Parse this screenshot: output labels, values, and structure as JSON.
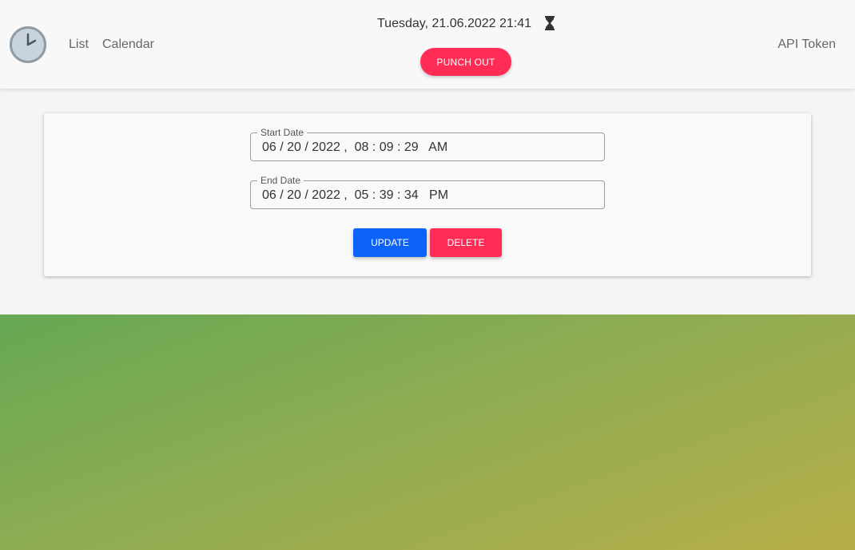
{
  "header": {
    "nav": {
      "list_label": "List",
      "calendar_label": "Calendar",
      "api_token_label": "API Token"
    },
    "datetime": "Tuesday, 21.06.2022 21:41",
    "status_icon": "hourglass-icon",
    "punch_button_label": "PUNCH OUT",
    "logo_icon": "clock-icon"
  },
  "form": {
    "start_date": {
      "label": "Start Date",
      "value": "06 / 20 / 2022 ,  08 : 09 : 29   AM"
    },
    "end_date": {
      "label": "End Date",
      "value": "06 / 20 / 2022 ,  05 : 39 : 34   PM"
    },
    "update_label": "UPDATE",
    "delete_label": "DELETE"
  },
  "colors": {
    "primary": "#0d63f8",
    "danger": "#ff2d55",
    "gradient_start": "#66a854",
    "gradient_end": "#b7ae48"
  }
}
